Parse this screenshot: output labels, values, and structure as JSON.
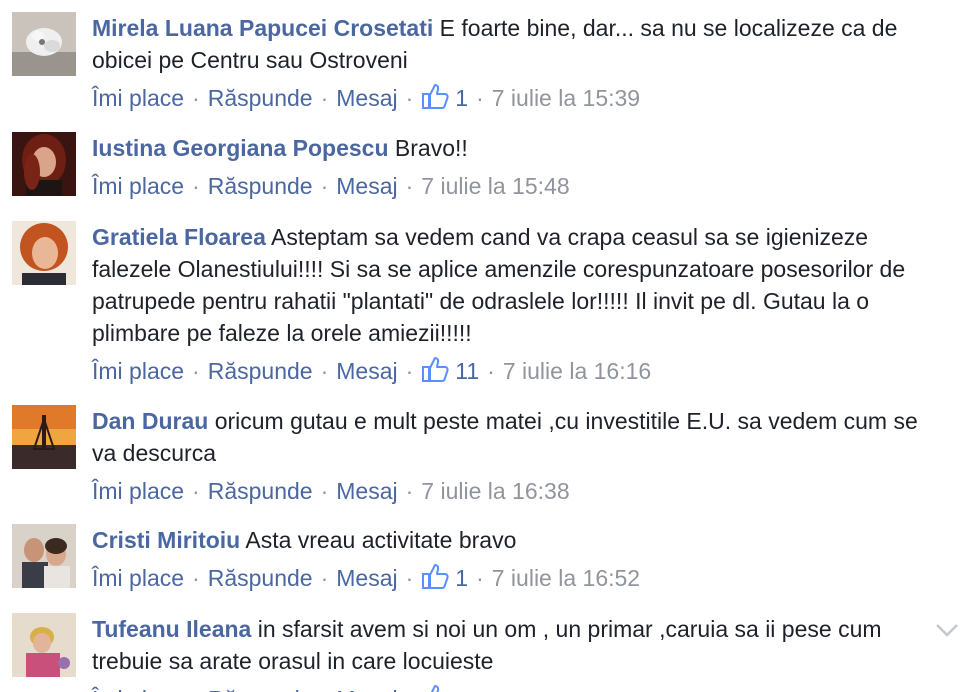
{
  "actions": {
    "like": "Îmi place",
    "reply": "Răspunde",
    "message": "Mesaj",
    "separator": "·"
  },
  "comments": [
    {
      "author": "Mirela Luana Papucei Crosetati",
      "text": "E foarte bine, dar... sa nu se localizeze ca de obicei pe Centru sau Ostroveni",
      "likes": "1",
      "time": "7 iulie la 15:39"
    },
    {
      "author": "Iustina Georgiana Popescu",
      "text": "Bravo!!",
      "likes": "",
      "time": "7 iulie la 15:48"
    },
    {
      "author": "Gratiela Floarea",
      "text": "Asteptam sa vedem cand va crapa ceasul sa se igienizeze falezele Olanestiului!!!! Si sa se aplice amenzile corespunzatoare posesorilor de patrupede pentru rahatii \"plantati\" de odraslele lor!!!!! Il invit pe dl. Gutau la o plimbare pe faleze la orele amiezii!!!!!",
      "likes": "11",
      "time": "7 iulie la 16:16"
    },
    {
      "author": "Dan Durau",
      "text": "oricum gutau e mult peste matei ,cu investitile E.U. sa vedem cum se va descurca",
      "likes": "",
      "time": "7 iulie la 16:38"
    },
    {
      "author": "Cristi Miritoiu",
      "text": "Asta vreau activitate bravo",
      "likes": "1",
      "time": "7 iulie la 16:52"
    },
    {
      "author": "Tufeanu Ileana",
      "text": "in sfarsit avem si noi un om , un primar ,caruia sa ii pese cum trebuie sa arate orasul in care locuieste",
      "likes": "",
      "time": ""
    }
  ],
  "icons": {
    "like": "thumbs-up-icon",
    "more": "chevron-down-icon"
  },
  "colors": {
    "author": "#4b67a1",
    "link": "#4b67a1",
    "text": "#1d2129",
    "meta": "#90949c",
    "like_icon": "#5890ff"
  }
}
